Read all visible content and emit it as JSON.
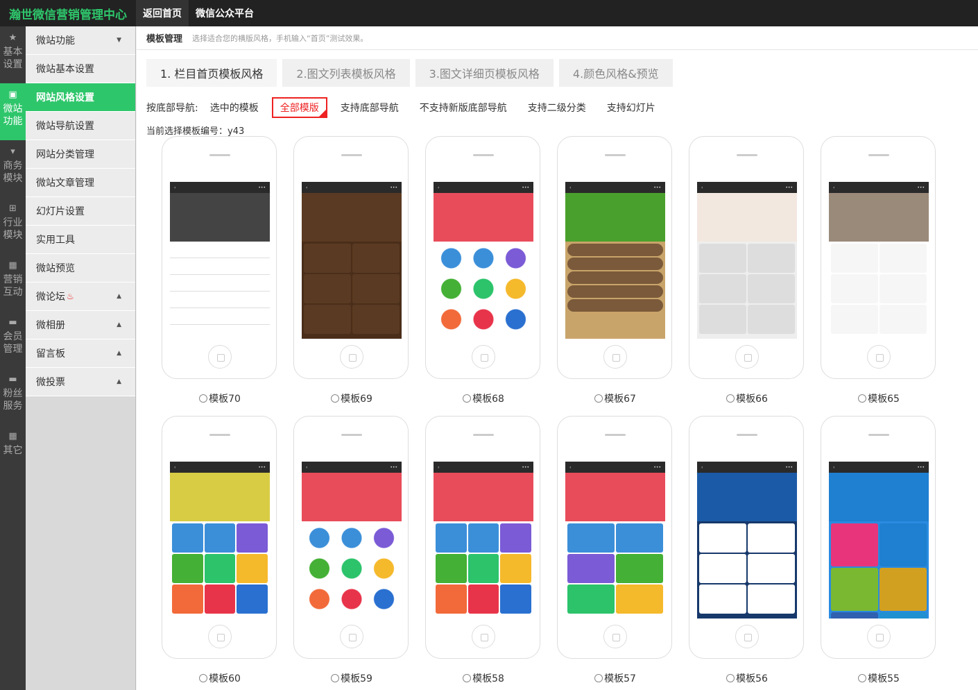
{
  "brand": "瀚世微信营销管理中心",
  "topnav": [
    "返回首页",
    "微信公众平台"
  ],
  "iconnav": [
    {
      "label": "基本设置",
      "icon": "star-icon"
    },
    {
      "label": "微站功能",
      "icon": "briefcase-icon"
    },
    {
      "label": "商务模块",
      "icon": "cart-icon"
    },
    {
      "label": "行业模块",
      "icon": "sitemap-icon"
    },
    {
      "label": "营销互动",
      "icon": "gift-icon"
    },
    {
      "label": "会员管理",
      "icon": "card-icon"
    },
    {
      "label": "粉丝服务",
      "icon": "card-icon"
    },
    {
      "label": "其它",
      "icon": "gift-icon"
    }
  ],
  "menu": [
    {
      "label": "微站功能",
      "arrow": "down"
    },
    {
      "label": "微站基本设置"
    },
    {
      "label": "网站风格设置",
      "active": true
    },
    {
      "label": "微站导航设置"
    },
    {
      "label": "网站分类管理"
    },
    {
      "label": "微站文章管理"
    },
    {
      "label": "幻灯片设置"
    },
    {
      "label": "实用工具"
    },
    {
      "label": "微站预览"
    },
    {
      "label": "微论坛",
      "arrow": "up",
      "hot": true
    },
    {
      "label": "微相册",
      "arrow": "up"
    },
    {
      "label": "留言板",
      "arrow": "up"
    },
    {
      "label": "微投票",
      "arrow": "up"
    }
  ],
  "crumb": {
    "title": "模板管理",
    "hint": "选择适合您的横版风格，手机输入“首页”测试效果。"
  },
  "tabs": [
    "1. 栏目首页模板风格",
    "2.图文列表模板风格",
    "3.图文详细页模板风格",
    "4.颜色风格&预览"
  ],
  "filter": {
    "label": "按底部导航:",
    "options": [
      "选中的模板",
      "全部模版",
      "支持底部导航",
      "不支持新版底部导航",
      "支持二级分类",
      "支持幻灯片"
    ],
    "active_index": 1
  },
  "current": "当前选择模板编号：y43",
  "templates": [
    {
      "name": "模板70",
      "hero": "#444",
      "body": "#fff",
      "tile": "list"
    },
    {
      "name": "模板69",
      "hero": "#5a3a22",
      "body": "#4a2e1a",
      "tile": "#5a3a22"
    },
    {
      "name": "模板68",
      "hero": "#e84c5a",
      "body": "#fff",
      "tile": "circles"
    },
    {
      "name": "模板67",
      "hero": "#4aa02c",
      "body": "#c9a46a",
      "tile": "wood"
    },
    {
      "name": "模板66",
      "hero": "#f3e8e0",
      "body": "#eee",
      "tile": "#ddd"
    },
    {
      "name": "模板65",
      "hero": "#9a8a7a",
      "body": "#fff",
      "tile": "#f6f6f6"
    },
    {
      "name": "模板60",
      "hero": "#d8cc44",
      "body": "#fff",
      "tile": "color"
    },
    {
      "name": "模板59",
      "hero": "#e84c5a",
      "body": "#fff",
      "tile": "circles2"
    },
    {
      "name": "模板58",
      "hero": "#e84c5a",
      "body": "#fff",
      "tile": "color2"
    },
    {
      "name": "模板57",
      "hero": "#e84c5a",
      "body": "#fff",
      "tile": "color3"
    },
    {
      "name": "模板56",
      "hero": "#1b5aa6",
      "body": "#16386b",
      "tile": "#fff"
    },
    {
      "name": "模板55",
      "hero": "#1f7fd0",
      "body": "#2a8be0",
      "tile": "metro"
    }
  ]
}
